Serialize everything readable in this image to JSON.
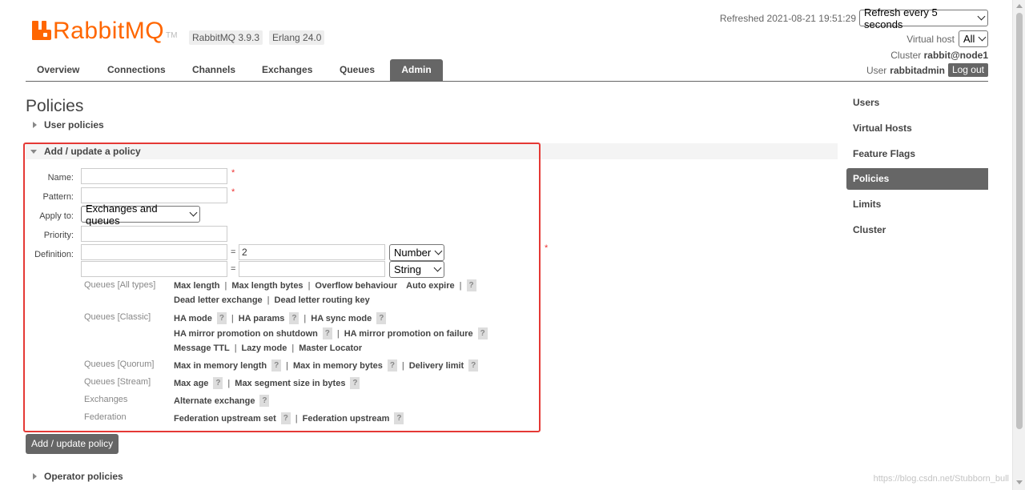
{
  "header": {
    "logo_text": "RabbitMQ",
    "logo_tm": "TM",
    "version": "RabbitMQ 3.9.3",
    "erlang": "Erlang 24.0",
    "refreshed_label": "Refreshed 2021-08-21 19:51:29",
    "refresh_select": "Refresh every 5 seconds",
    "vhost_label": "Virtual host",
    "vhost_select": "All",
    "cluster_label": "Cluster",
    "cluster_name": "rabbit@node1",
    "user_label": "User",
    "user_name": "rabbitadmin",
    "logout": "Log out"
  },
  "nav": {
    "tabs": [
      {
        "label": "Overview"
      },
      {
        "label": "Connections"
      },
      {
        "label": "Channels"
      },
      {
        "label": "Exchanges"
      },
      {
        "label": "Queues"
      },
      {
        "label": "Admin"
      }
    ],
    "active": "Admin"
  },
  "main": {
    "title": "Policies",
    "user_policies": "User policies",
    "add_update_section": "Add / update a policy",
    "form": {
      "name_label": "Name:",
      "pattern_label": "Pattern:",
      "apply_label": "Apply to:",
      "apply_value": "Exchanges and queues",
      "priority_label": "Priority:",
      "definition_label": "Definition:",
      "required_mark": "*",
      "equals": "=",
      "def_row1_value": "2",
      "def_row1_type": "Number",
      "def_row2_type": "String"
    },
    "groups": {
      "all_types": "Queues [All types]",
      "classic": "Queues [Classic]",
      "quorum": "Queues [Quorum]",
      "stream": "Queues [Stream]",
      "exchanges": "Exchanges",
      "federation": "Federation"
    },
    "options": {
      "max_length": "Max length",
      "max_length_bytes": "Max length bytes",
      "overflow_behaviour": "Overflow behaviour",
      "auto_expire": "Auto expire",
      "dead_letter_exchange": "Dead letter exchange",
      "dead_letter_routing_key": "Dead letter routing key",
      "ha_mode": "HA mode",
      "ha_params": "HA params",
      "ha_sync_mode": "HA sync mode",
      "ha_promo_shutdown": "HA mirror promotion on shutdown",
      "ha_promo_failure": "HA mirror promotion on failure",
      "message_ttl": "Message TTL",
      "lazy_mode": "Lazy mode",
      "master_locator": "Master Locator",
      "max_in_memory_length": "Max in memory length",
      "max_in_memory_bytes": "Max in memory bytes",
      "delivery_limit": "Delivery limit",
      "max_age": "Max age",
      "max_segment_size": "Max segment size in bytes",
      "alternate_exchange": "Alternate exchange",
      "federation_upstream_set": "Federation upstream set",
      "federation_upstream": "Federation upstream"
    },
    "help_glyph": "?",
    "separator": "|",
    "submit": "Add / update policy",
    "operator_policies": "Operator policies"
  },
  "sidebar": {
    "items": [
      {
        "label": "Users"
      },
      {
        "label": "Virtual Hosts"
      },
      {
        "label": "Feature Flags"
      },
      {
        "label": "Policies"
      },
      {
        "label": "Limits"
      },
      {
        "label": "Cluster"
      }
    ],
    "active": "Policies"
  },
  "watermark": "https://blog.csdn.net/Stubborn_bull",
  "colors": {
    "brand": "#ff6600",
    "active_tab": "#666666",
    "highlight_box": "#e53935"
  }
}
